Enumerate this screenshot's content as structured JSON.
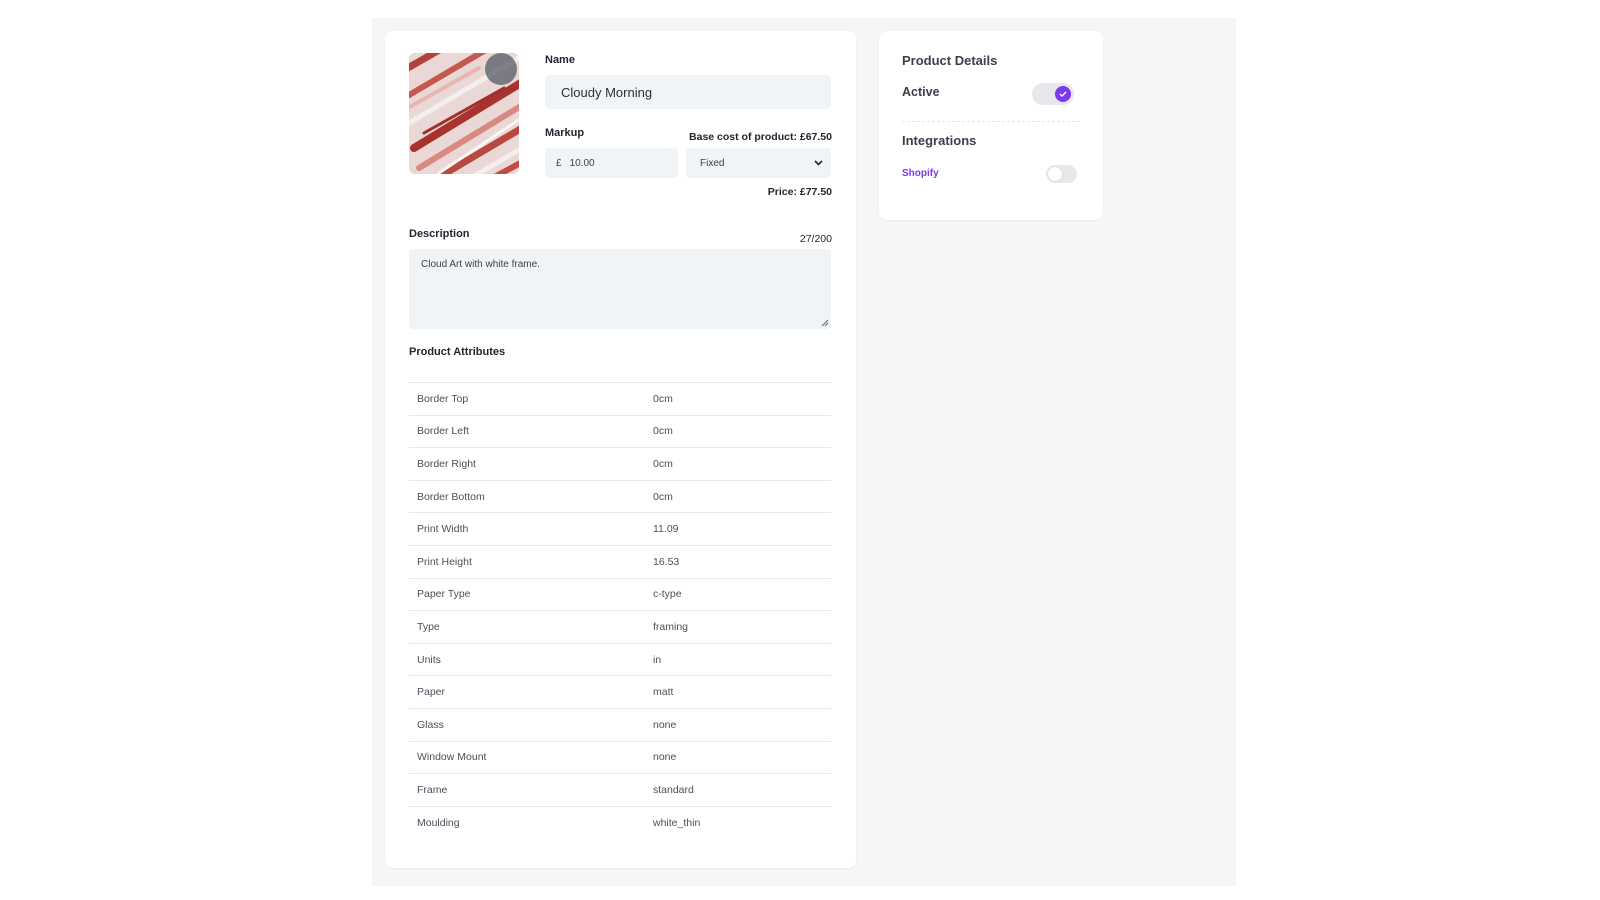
{
  "product": {
    "thumbnail_icon": "product-art-thumbnail",
    "name_label": "Name",
    "name_value": "Cloudy Morning",
    "markup_label": "Markup",
    "base_cost": "Base cost of product: £67.50",
    "markup_currency": "£",
    "markup_value": "10.00",
    "markup_type": "Fixed",
    "price": "Price: £77.50",
    "description_label": "Description",
    "description_count": "27/200",
    "description_value": "Cloud Art with white frame.",
    "attributes_label": "Product Attributes",
    "attributes": [
      {
        "name": "Border Top",
        "value": "0cm"
      },
      {
        "name": "Border Left",
        "value": "0cm"
      },
      {
        "name": "Border Right",
        "value": "0cm"
      },
      {
        "name": "Border Bottom",
        "value": "0cm"
      },
      {
        "name": "Print Width",
        "value": "11.09"
      },
      {
        "name": "Print Height",
        "value": "16.53"
      },
      {
        "name": "Paper Type",
        "value": "c-type"
      },
      {
        "name": "Type",
        "value": "framing"
      },
      {
        "name": "Units",
        "value": "in"
      },
      {
        "name": "Paper",
        "value": "matt"
      },
      {
        "name": "Glass",
        "value": "none"
      },
      {
        "name": "Window Mount",
        "value": "none"
      },
      {
        "name": "Frame",
        "value": "standard"
      },
      {
        "name": "Moulding",
        "value": "white_thin"
      }
    ]
  },
  "details": {
    "title": "Product Details",
    "active_label": "Active",
    "active_on": true,
    "integrations_title": "Integrations",
    "shopify_label": "Shopify",
    "shopify_on": false
  },
  "colors": {
    "accent": "#7c3aed",
    "input_bg": "#f1f4f7",
    "canvas_bg": "#f6f6f7"
  }
}
